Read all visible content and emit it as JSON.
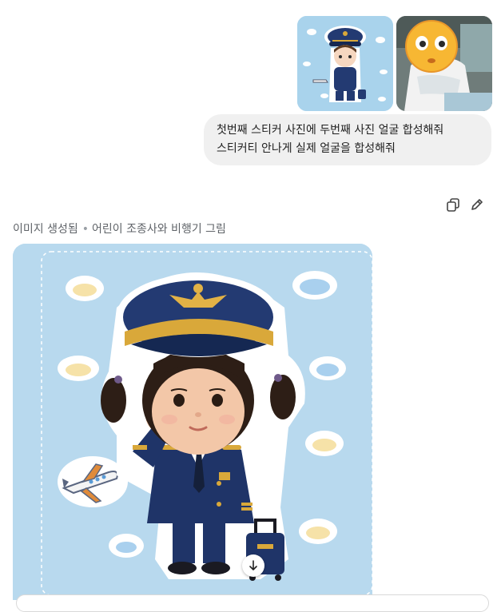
{
  "user_message": {
    "text_line1": "첫번째 스티커 사진에 두번째 사진 얼굴 합성해줘",
    "text_line2": "스티커티 안나게 실제 얼굴을 합성해줘",
    "attachments": [
      {
        "kind": "image",
        "icon": "pilot-sticker-thumbnail"
      },
      {
        "kind": "image",
        "icon": "photo-with-emoji-face"
      }
    ],
    "actions": [
      {
        "icon": "copy-icon"
      },
      {
        "icon": "edit-pencil-icon"
      }
    ]
  },
  "response": {
    "status_label": "이미지 생성됨",
    "separator": "•",
    "image_title": "어린이 조종사와 비행기 그림",
    "image": {
      "icon": "child-pilot-sticker",
      "background": "#b8d9ee"
    },
    "download_icon": "download-arrow-icon"
  },
  "colors": {
    "bubble_bg": "#f0f0f0",
    "muted_text": "#5f6368",
    "sky_blue": "#b8d9ee",
    "navy": "#1f3468",
    "gold": "#d9a83a"
  }
}
